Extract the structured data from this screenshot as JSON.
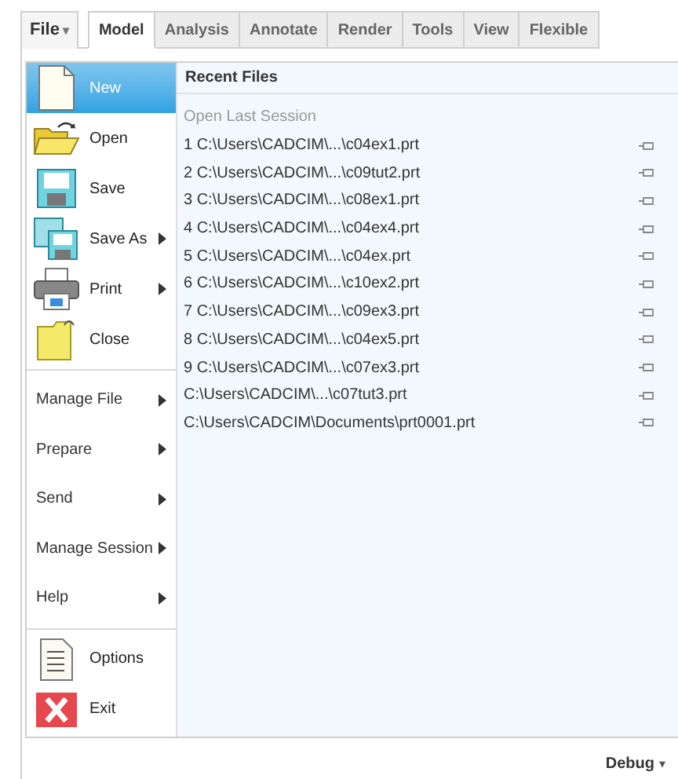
{
  "file_button": {
    "label": "File",
    "caret": "▾"
  },
  "tabs": [
    {
      "label": "Model",
      "selected": true
    },
    {
      "label": "Analysis",
      "selected": false
    },
    {
      "label": "Annotate",
      "selected": false
    },
    {
      "label": "Render",
      "selected": false
    },
    {
      "label": "Tools",
      "selected": false
    },
    {
      "label": "View",
      "selected": false
    },
    {
      "label": "Flexible",
      "selected": false
    }
  ],
  "menu": {
    "items": [
      {
        "kind": "icon",
        "label": "New",
        "submenu": false,
        "selected": true
      },
      {
        "kind": "icon",
        "label": "Open",
        "submenu": false,
        "selected": false
      },
      {
        "kind": "icon",
        "label": "Save",
        "submenu": false,
        "selected": false
      },
      {
        "kind": "icon",
        "label": "Save As",
        "submenu": true,
        "selected": false
      },
      {
        "kind": "icon",
        "label": "Print",
        "submenu": true,
        "selected": false
      },
      {
        "kind": "icon",
        "label": "Close",
        "submenu": false,
        "selected": false
      },
      {
        "kind": "separator"
      },
      {
        "kind": "text",
        "label": "Manage File",
        "submenu": true,
        "selected": false
      },
      {
        "kind": "text",
        "label": "Prepare",
        "submenu": true,
        "selected": false
      },
      {
        "kind": "text",
        "label": "Send",
        "submenu": true,
        "selected": false
      },
      {
        "kind": "text",
        "label": "Manage Session",
        "submenu": true,
        "selected": false
      },
      {
        "kind": "text",
        "label": "Help",
        "submenu": true,
        "selected": false
      },
      {
        "kind": "separator"
      },
      {
        "kind": "icon",
        "label": "Options",
        "submenu": false,
        "selected": false
      },
      {
        "kind": "icon",
        "label": "Exit",
        "submenu": false,
        "selected": false
      }
    ]
  },
  "recent": {
    "title": "Recent Files",
    "last_session": "Open Last Session",
    "files": [
      {
        "label": "1 C:\\Users\\CADCIM\\...\\c04ex1.prt"
      },
      {
        "label": "2 C:\\Users\\CADCIM\\...\\c09tut2.prt"
      },
      {
        "label": "3 C:\\Users\\CADCIM\\...\\c08ex1.prt"
      },
      {
        "label": "4 C:\\Users\\CADCIM\\...\\c04ex4.prt"
      },
      {
        "label": "5 C:\\Users\\CADCIM\\...\\c04ex.prt"
      },
      {
        "label": "6 C:\\Users\\CADCIM\\...\\c10ex2.prt"
      },
      {
        "label": "7 C:\\Users\\CADCIM\\...\\c09ex3.prt"
      },
      {
        "label": "8 C:\\Users\\CADCIM\\...\\c04ex5.prt"
      },
      {
        "label": "9 C:\\Users\\CADCIM\\...\\c07ex3.prt"
      },
      {
        "label": "C:\\Users\\CADCIM\\...\\c07tut3.prt"
      },
      {
        "label": "C:\\Users\\CADCIM\\Documents\\prt0001.prt"
      }
    ]
  },
  "status": {
    "label": "Debug",
    "caret": "▾"
  }
}
